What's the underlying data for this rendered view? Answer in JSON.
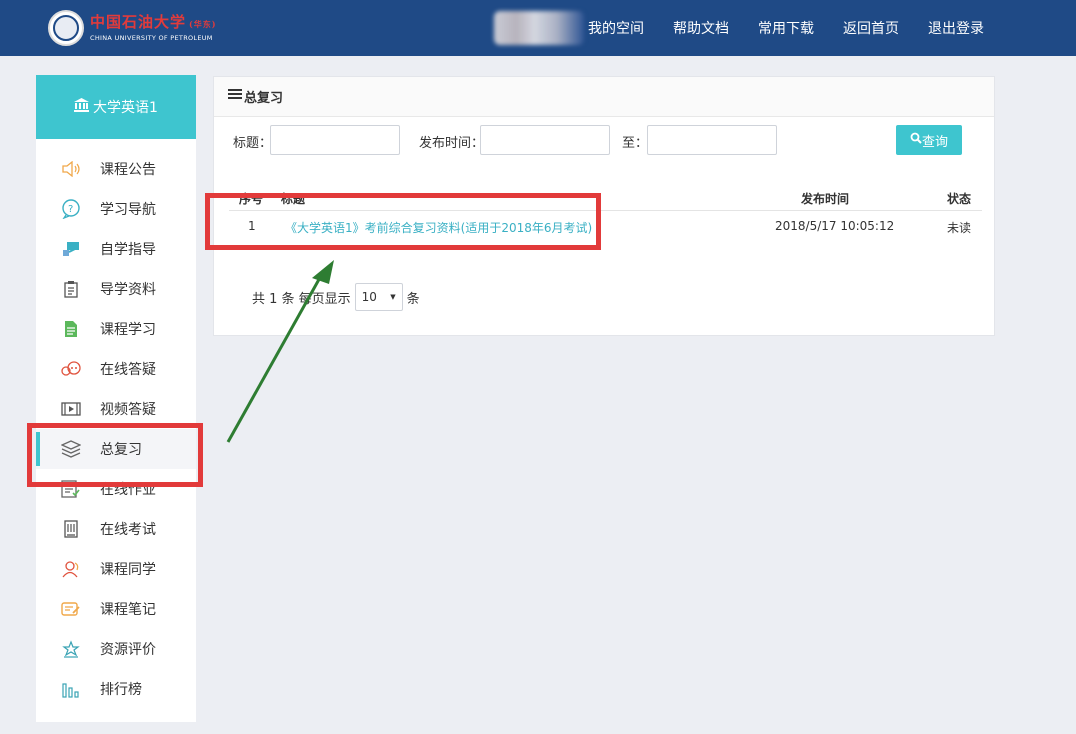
{
  "header": {
    "logo_cn": "中国石油大学",
    "logo_cn_suffix": "(华东)",
    "logo_en": "CHINA UNIVERSITY OF PETROLEUM",
    "nav": [
      "我的空间",
      "帮助文档",
      "常用下载",
      "返回首页",
      "退出登录"
    ]
  },
  "sidebar": {
    "course_name": "大学英语1",
    "items": [
      {
        "label": "课程公告",
        "icon": "speaker-icon"
      },
      {
        "label": "学习导航",
        "icon": "help-circle-icon"
      },
      {
        "label": "自学指导",
        "icon": "pointer-icon"
      },
      {
        "label": "导学资料",
        "icon": "clipboard-icon"
      },
      {
        "label": "课程学习",
        "icon": "document-icon"
      },
      {
        "label": "在线答疑",
        "icon": "chat-icon"
      },
      {
        "label": "视频答疑",
        "icon": "film-icon"
      },
      {
        "label": "总复习",
        "icon": "layers-icon"
      },
      {
        "label": "在线作业",
        "icon": "checklist-icon"
      },
      {
        "label": "在线考试",
        "icon": "exam-icon"
      },
      {
        "label": "课程同学",
        "icon": "classmates-icon"
      },
      {
        "label": "课程笔记",
        "icon": "notes-icon"
      },
      {
        "label": "资源评价",
        "icon": "rating-icon"
      },
      {
        "label": "排行榜",
        "icon": "bar-chart-icon"
      }
    ],
    "active_label": "总复习"
  },
  "panel": {
    "title": "总复习",
    "filters": {
      "title_label": "标题：",
      "date_label": "发布时间：",
      "to_label": "至：",
      "search_label": "查询"
    },
    "table": {
      "headers": {
        "index": "序号",
        "title": "标题",
        "date": "发布时间",
        "status": "状态"
      },
      "rows": [
        {
          "index": "1",
          "title": "《大学英语1》考前综合复习资料(适用于2018年6月考试)",
          "date": "2018/5/17 10:05:12",
          "status": "未读"
        }
      ]
    },
    "pager": {
      "prefix": "共 1 条 每页显示",
      "page_size": "10",
      "suffix": "条"
    }
  },
  "colors": {
    "header_bg": "#1f4a86",
    "accent": "#3ec5cf",
    "link": "#3ab0c4",
    "highlight_box": "#e23a3a",
    "arrow": "#2e7d32"
  }
}
